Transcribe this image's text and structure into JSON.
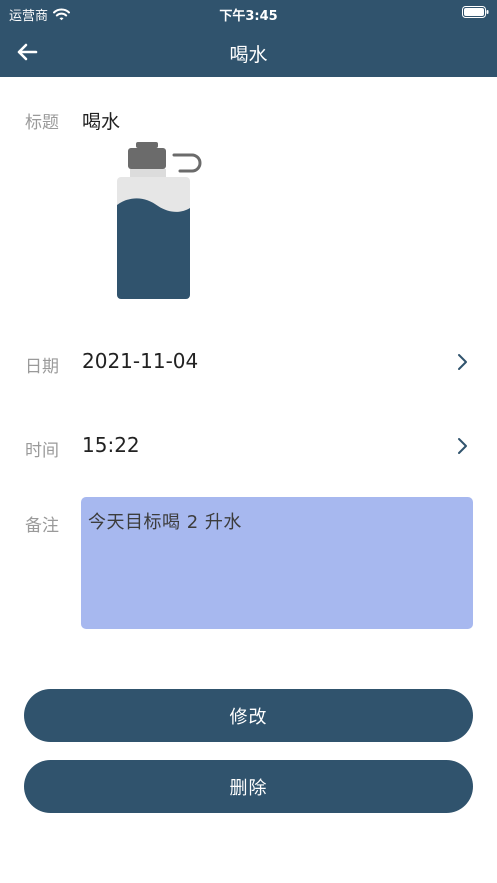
{
  "status_bar": {
    "carrier": "运营商",
    "time": "下午3:45"
  },
  "nav": {
    "title": "喝水"
  },
  "form": {
    "title_label": "标题",
    "title_value": "喝水",
    "date_label": "日期",
    "date_value": "2021-11-04",
    "time_label": "时间",
    "time_value": "15:22",
    "notes_label": "备注",
    "notes_value": "今天目标喝 2 升水"
  },
  "actions": {
    "modify_label": "修改",
    "delete_label": "删除"
  },
  "colors": {
    "header": "#30536d",
    "notes_background": "#a7b8ef",
    "button": "#30536d"
  },
  "icons": {
    "back": "arrow-left-icon",
    "wifi": "wifi-icon",
    "battery": "battery-icon",
    "chevron": "chevron-right-icon",
    "bottle": "water-bottle-icon"
  }
}
